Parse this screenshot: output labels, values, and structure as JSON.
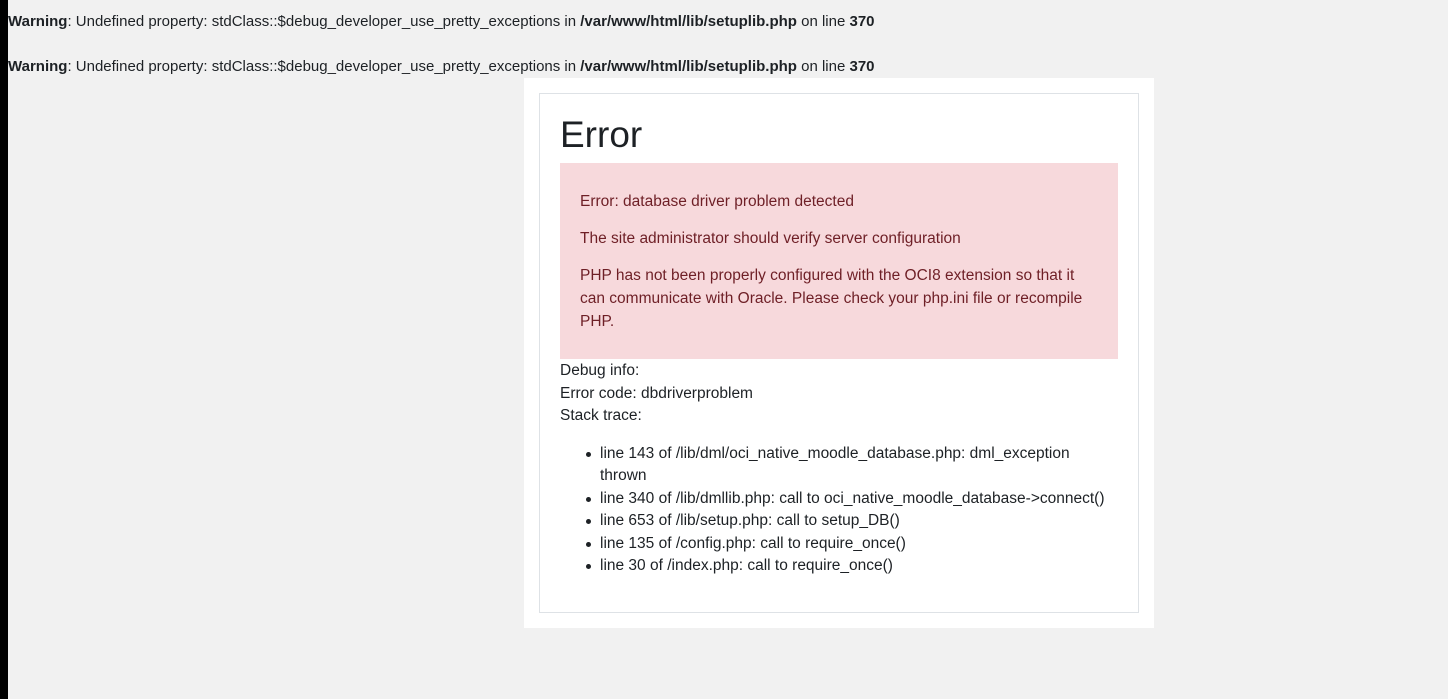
{
  "warnings": [
    {
      "label": "Warning",
      "message": ": Undefined property: stdClass::$debug_developer_use_pretty_exceptions in ",
      "file": "/var/www/html/lib/setuplib.php",
      "on_line": " on line ",
      "line": "370"
    },
    {
      "label": "Warning",
      "message": ": Undefined property: stdClass::$debug_developer_use_pretty_exceptions in ",
      "file": "/var/www/html/lib/setuplib.php",
      "on_line": " on line ",
      "line": "370"
    }
  ],
  "error": {
    "title": "Error",
    "alert": {
      "heading": "Error: database driver problem detected",
      "admin_note": "The site administrator should verify server configuration",
      "details": "PHP has not been properly configured with the OCI8 extension so that it can communicate with Oracle. Please check your php.ini file or recompile PHP.",
      "bg_color": "#f7d9dc",
      "text_color": "#6e1f26"
    },
    "debug_info_label": "Debug info:",
    "error_code_label": "Error code: dbdriverproblem",
    "stack_trace_label": "Stack trace:",
    "stack_trace": [
      "line 143 of /lib/dml/oci_native_moodle_database.php: dml_exception thrown",
      "line 340 of /lib/dmllib.php: call to oci_native_moodle_database->connect()",
      "line 653 of /lib/setup.php: call to setup_DB()",
      "line 135 of /config.php: call to require_once()",
      "line 30 of /index.php: call to require_once()"
    ]
  }
}
